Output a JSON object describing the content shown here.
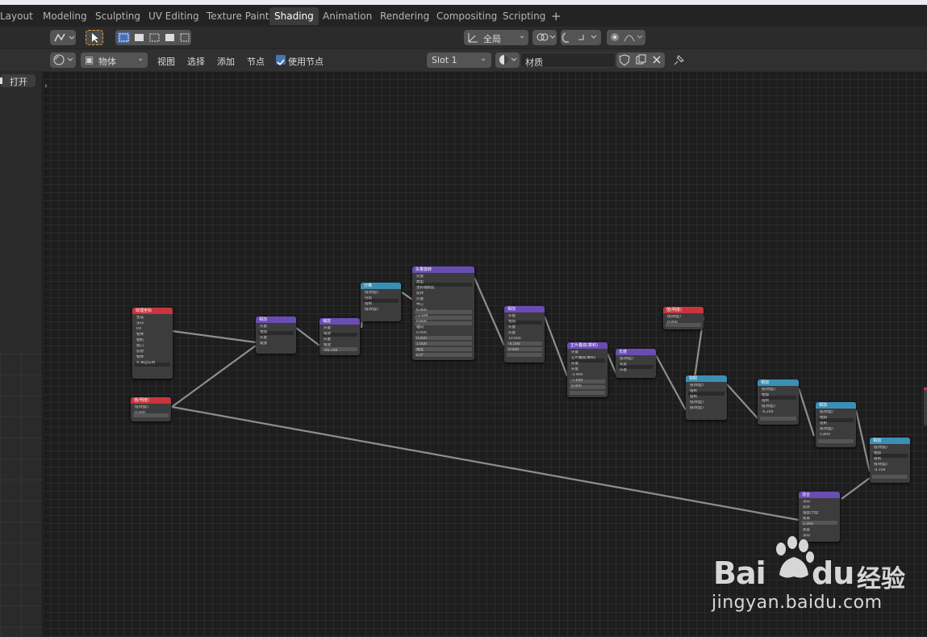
{
  "tabs": [
    "Layout",
    "Modeling",
    "Sculpting",
    "UV Editing",
    "Texture Paint",
    "Shading",
    "Animation",
    "Rendering",
    "Compositing",
    "Scripting"
  ],
  "active_tab": "Shading",
  "add_tab_glyph": "+",
  "toolbar": {
    "orientation": "全局",
    "object_mode": "物体",
    "menus": [
      "视图",
      "选择",
      "添加",
      "节点"
    ],
    "use_nodes_label": "使用节点",
    "use_nodes_checked": true,
    "slot": "Slot 1",
    "material_name": "材质"
  },
  "left_panel": {
    "open_button": "打开"
  },
  "nodes": [
    {
      "id": "texcoord",
      "title": "纹理坐标",
      "color": "#c9353d",
      "lines": [
        "生成",
        "法向",
        "UV",
        "物体",
        "相机",
        "窗口",
        "反射",
        "物体",
        "≡ 来自实例"
      ]
    },
    {
      "id": "value1",
      "title": "值(明度)",
      "color": "#c9353d",
      "lines": [
        "值(明度)",
        "0.500"
      ]
    },
    {
      "id": "mix1",
      "title": "相加",
      "color": "#6a4cb5",
      "lines": [
        "矢量",
        "相加",
        "矢量",
        "缩放"
      ]
    },
    {
      "id": "scale1",
      "title": "缩放",
      "color": "#6a4cb5",
      "lines": [
        "矢量",
        "缩放",
        "矢量",
        "缩放",
        "-66.100"
      ]
    },
    {
      "id": "sep1",
      "title": "分离",
      "color": "#3a8fb5",
      "lines": [
        "值(明度)",
        "分段",
        "钳制",
        "值(明度)"
      ]
    },
    {
      "id": "vecrot",
      "title": "矢量旋转",
      "color": "#6a4cb5",
      "lines": [
        "矢量",
        "类型",
        "坐标轴角度",
        "反转",
        "矢量",
        "中心",
        "6.400",
        "-3.500",
        "0.600",
        "轴向",
        "0.000",
        "0.000",
        "1.000",
        "角度",
        "0.4°"
      ]
    },
    {
      "id": "add2",
      "title": "相加",
      "color": "#6a4cb5",
      "lines": [
        "矢量",
        "相加",
        "矢量",
        "矢量",
        "10.600",
        "-0.500",
        "0.000"
      ]
    },
    {
      "id": "mapping",
      "title": "正片叠底(乘积)",
      "color": "#6a4cb5",
      "lines": [
        "矢量",
        "正片叠底(乘积)",
        "矢量",
        "矢量",
        "-3.900",
        "-7.600",
        "0.000"
      ]
    },
    {
      "id": "length",
      "title": "长度",
      "color": "#6a4cb5",
      "lines": [
        "值(明度)",
        "长度",
        "矢量"
      ]
    },
    {
      "id": "value2",
      "title": "值(明度)",
      "color": "#c9353d",
      "lines": [
        "值(明度)",
        "0.000"
      ]
    },
    {
      "id": "math1",
      "title": "钳制",
      "color": "#3a8fb5",
      "lines": [
        "值(明度)",
        "钳制",
        "钳制",
        "值(明度)",
        "值(明度)"
      ]
    },
    {
      "id": "math2",
      "title": "相加",
      "color": "#3a8fb5",
      "lines": [
        "值(明度)",
        "相加",
        "钳制",
        "值(明度)",
        "-6.200"
      ]
    },
    {
      "id": "math3",
      "title": "相加",
      "color": "#3a8fb5",
      "lines": [
        "值(明度)",
        "相加",
        "钳制",
        "值(明度)",
        "5.800"
      ]
    },
    {
      "id": "math4",
      "title": "相加",
      "color": "#3a8fb5",
      "lines": [
        "值(明度)",
        "相加",
        "钳制",
        "值(明度)",
        "-4.100"
      ]
    },
    {
      "id": "mixfinal",
      "title": "混合",
      "color": "#6a4cb5",
      "lines": [
        "法向",
        "反转",
        "强度/力度",
        "距离",
        "1.000",
        "高度",
        "法向"
      ]
    }
  ],
  "watermark": {
    "logo": "Bai",
    "logo2": "du",
    "cn": "经验",
    "url": "jingyan.baidu.com"
  }
}
